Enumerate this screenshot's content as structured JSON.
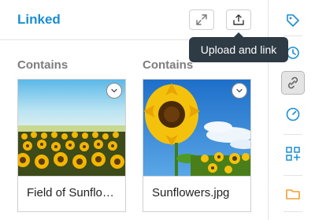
{
  "header": {
    "title": "Linked",
    "expand_icon": "expand-icon",
    "upload_icon": "upload-icon"
  },
  "tooltip": {
    "text": "Upload and link"
  },
  "columns": [
    {
      "label": "Contains",
      "file_name": "Field of Sunflo…",
      "menu_icon": "chevron-down-icon"
    },
    {
      "label": "Contains",
      "file_name": "Sunflowers.jpg",
      "menu_icon": "chevron-down-icon"
    }
  ],
  "sidebar": {
    "items": [
      {
        "icon": "tag-icon"
      },
      {
        "icon": "history-icon"
      },
      {
        "icon": "link-icon",
        "active": true
      },
      {
        "icon": "gauge-icon"
      },
      {
        "icon": "grid-add-icon"
      },
      {
        "icon": "folder-icon"
      }
    ]
  },
  "colors": {
    "accent": "#1a8fd1",
    "rail_icon": "#1a8fd1",
    "folder_icon": "#f0a030",
    "tooltip_bg": "#2e3a44",
    "label_gray": "#7d7d7d"
  }
}
